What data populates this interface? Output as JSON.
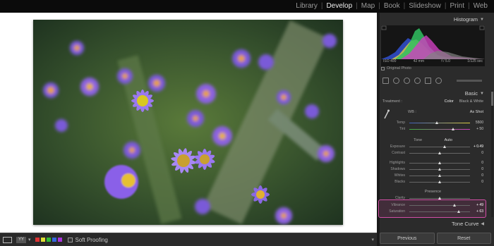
{
  "modules": [
    "Library",
    "Develop",
    "Map",
    "Book",
    "Slideshow",
    "Print",
    "Web"
  ],
  "active_module": "Develop",
  "panel": {
    "histogram_title": "Histogram",
    "histogram_meta": {
      "iso": "ISO 400",
      "focal": "42 mm",
      "aperture": "f / 5.0",
      "shutter": "1/125 sec"
    },
    "original_photo": "Original Photo",
    "basic_title": "Basic",
    "treatment_label": "Treatment :",
    "treatment_color": "Color",
    "treatment_bw": "Black & White",
    "wb_label": "WB :",
    "wb_value": "As Shot",
    "tone_label": "Tone",
    "tone_auto": "Auto",
    "presence_label": "Presence",
    "tone_curve_title": "Tone Curve",
    "sliders": [
      {
        "name": "Temp",
        "value": "5500",
        "pos": 0.45
      },
      {
        "name": "Tint",
        "value": "+ 50",
        "pos": 0.72
      },
      {
        "name": "Exposure",
        "value": "+ 0.49",
        "pos": 0.58
      },
      {
        "name": "Contrast",
        "value": "0",
        "pos": 0.5
      },
      {
        "name": "Highlights",
        "value": "0",
        "pos": 0.5
      },
      {
        "name": "Shadows",
        "value": "0",
        "pos": 0.5
      },
      {
        "name": "Whites",
        "value": "0",
        "pos": 0.5
      },
      {
        "name": "Blacks",
        "value": "0",
        "pos": 0.5
      },
      {
        "name": "Clarity",
        "value": "",
        "pos": 0.5
      },
      {
        "name": "Vibrance",
        "value": "+ 49",
        "pos": 0.74
      },
      {
        "name": "Saturation",
        "value": "+ 63",
        "pos": 0.81
      }
    ],
    "previous": "Previous",
    "reset": "Reset"
  },
  "toolbar": {
    "view_label": "YY",
    "soft_proofing": "Soft Proofing",
    "flag_colors": [
      "#d33",
      "#dd3",
      "#3b3",
      "#36d",
      "#a3d"
    ]
  },
  "colors": {
    "highlight": "#d24fa6"
  }
}
